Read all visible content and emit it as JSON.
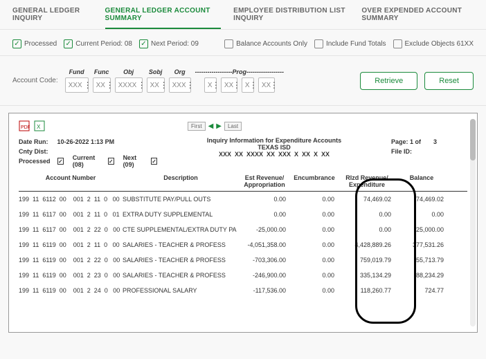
{
  "tabs": {
    "t0": "GENERAL LEDGER INQUIRY",
    "t1": "GENERAL LEDGER ACCOUNT SUMMARY",
    "t2": "EMPLOYEE DISTRIBUTION LIST INQUIRY",
    "t3": "OVER EXPENDED ACCOUNT SUMMARY"
  },
  "filters": {
    "processed": "Processed",
    "currentPeriod": "Current Period: 08",
    "nextPeriod": "Next Period: 09",
    "balanceOnly": "Balance Accounts Only",
    "includeFund": "Include Fund Totals",
    "excludeObj": "Exclude Objects 61XX"
  },
  "acct": {
    "label": "Account Code:",
    "segs": {
      "fund": {
        "lbl": "Fund",
        "ph": "XXX"
      },
      "func": {
        "lbl": "Func",
        "ph": "XX"
      },
      "obj": {
        "lbl": "Obj",
        "ph": "XXXX"
      },
      "sobj": {
        "lbl": "Sobj",
        "ph": "XX"
      },
      "org": {
        "lbl": "Org",
        "ph": "XXX"
      },
      "progHeader": "------------------Prog------------------",
      "p1": {
        "ph": "X"
      },
      "p2": {
        "ph": "XX"
      },
      "p3": {
        "ph": "X"
      },
      "p4": {
        "ph": "XX"
      }
    },
    "retrieve": "Retrieve",
    "reset": "Reset"
  },
  "report": {
    "nav": {
      "first": "First",
      "last": "Last"
    },
    "meta": {
      "dateRunLbl": "Date Run:",
      "dateRunVal": "10-26-2022 1:13 PM",
      "cntyLbl": "Cnty Dist:",
      "processedLbl": "Processed",
      "currentLbl": "Current (08)",
      "nextLbl": "Next (09)",
      "titleTop": "Inquiry Information for Expenditure Accounts",
      "titleOrg": "TEXAS ISD",
      "mask": "XXX  XX  XXXX  XX  XXX  X  XX  X  XX",
      "pageLbl": "Page: 1 of",
      "pageTotal": "3",
      "fileLbl": "File ID:"
    },
    "hdr": {
      "acct": "Account Number",
      "desc": "Description",
      "est1": "Est Revenue/",
      "est2": "Appropriation",
      "enc": "Encumbrance",
      "rlz1": "Rlzd Revenue/",
      "rlz2": "Expenditure",
      "bal": "Balance"
    },
    "rows": [
      {
        "n": "199  11  6112  00    001  2  11  0   00",
        "d": "SUBSTITUTE PAY/PULL OUTS",
        "e": "0.00",
        "c": "0.00",
        "r": "74,469.02",
        "b": "74,469.02"
      },
      {
        "n": "199  11  6117  00    001  2  11  0   01",
        "d": "EXTRA DUTY SUPPLEMENTAL",
        "e": "0.00",
        "c": "0.00",
        "r": "0.00",
        "b": "0.00"
      },
      {
        "n": "199  11  6117  00    001  2  22  0   00",
        "d": "CTE SUPPLEMENTAL/EXTRA DUTY PA",
        "e": "-25,000.00",
        "c": "0.00",
        "r": "0.00",
        "b": "-25,000.00"
      },
      {
        "n": "199  11  6119  00    001  2  11  0   00",
        "d": "SALARIES - TEACHER & PROFESS",
        "e": "-4,051,358.00",
        "c": "0.00",
        "r": "4,428,889.26",
        "b": "377,531.26"
      },
      {
        "n": "199  11  6119  00    001  2  22  0   00",
        "d": "SALARIES - TEACHER & PROFESS",
        "e": "-703,306.00",
        "c": "0.00",
        "r": "759,019.79",
        "b": "55,713.79"
      },
      {
        "n": "199  11  6119  00    001  2  23  0   00",
        "d": "SALARIES - TEACHER & PROFESS",
        "e": "-246,900.00",
        "c": "0.00",
        "r": "335,134.29",
        "b": "88,234.29"
      },
      {
        "n": "199  11  6119  00    001  2  24  0   00",
        "d": "PROFESSIONAL SALARY",
        "e": "-117,536.00",
        "c": "0.00",
        "r": "118,260.77",
        "b": "724.77"
      }
    ]
  }
}
